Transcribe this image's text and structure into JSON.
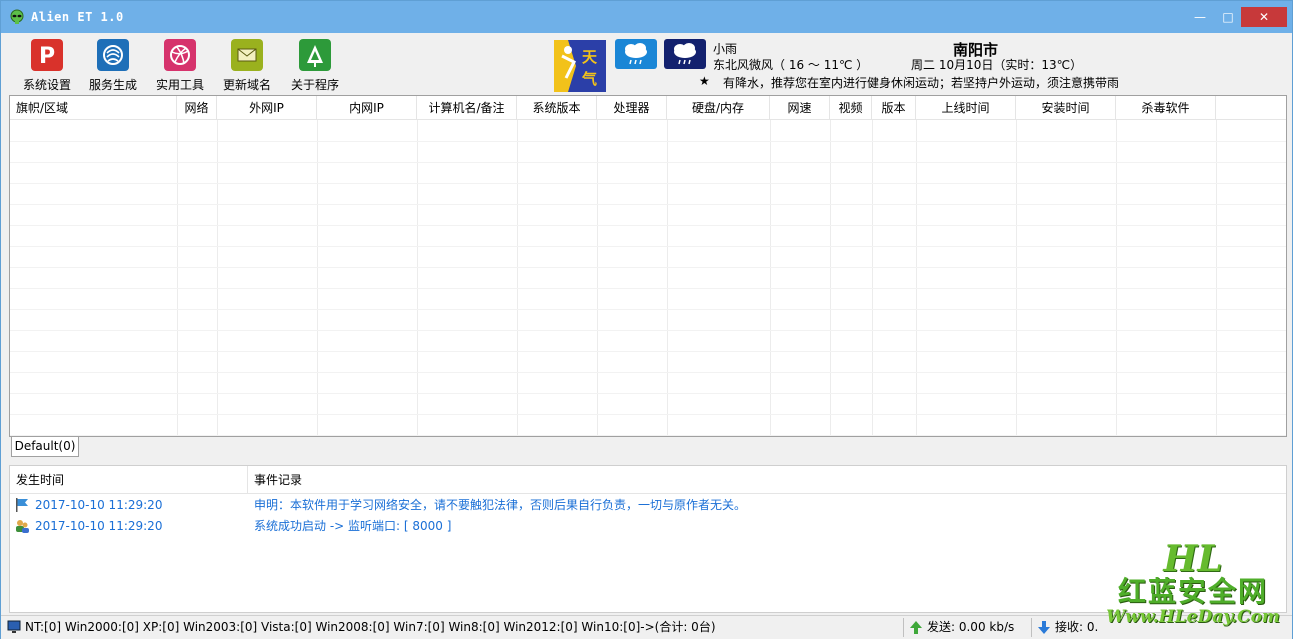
{
  "window": {
    "title": "Alien ET 1.0",
    "min": "—",
    "max": "□",
    "close": "✕"
  },
  "toolbar": {
    "buttons": [
      {
        "label": "系统设置",
        "icon": "pinterest-icon",
        "color": "#d9322b"
      },
      {
        "label": "服务生成",
        "icon": "spiral-icon",
        "color": "#1e6fb8"
      },
      {
        "label": "实用工具",
        "icon": "dribbble-icon",
        "color": "#d6336c"
      },
      {
        "label": "更新域名",
        "icon": "envelope-icon",
        "color": "#9ab11e"
      },
      {
        "label": "关于程序",
        "icon": "tree-icon",
        "color": "#2d9a3a"
      }
    ]
  },
  "weather": {
    "logo_text_1": "天",
    "logo_text_2": "气",
    "condition": "小雨",
    "wind_temp": "东北风微风（ 16 ～ 11℃ ）",
    "date": "周二 10月10日（实时：13℃）",
    "city": "南阳市",
    "advice_star": "★",
    "advice": "有降水，推荐您在室内进行健身休闲运动；若坚持户外运动，须注意携带雨"
  },
  "table": {
    "columns": [
      "旗帜/区域",
      "网络",
      "外网IP",
      "内网IP",
      "计算机名/备注",
      "系统版本",
      "处理器",
      "硬盘/内存",
      "网速",
      "视频",
      "版本",
      "上线时间",
      "安装时间",
      "杀毒软件"
    ],
    "tab": "Default(0)"
  },
  "log": {
    "columns": [
      "发生时间",
      "事件记录"
    ],
    "rows": [
      {
        "time": "2017-10-10 11:29:20",
        "msg": "申明：本软件用于学习网络安全，请不要触犯法律，否则后果自行负责，一切与原作者无关。",
        "icon": "flag-icon"
      },
      {
        "time": "2017-10-10 11:29:20",
        "msg": "系统成功启动 -> 监听端口: [ 8000 ]",
        "icon": "users-icon"
      }
    ]
  },
  "status": {
    "os_counts": "NT:[0] Win2000:[0] XP:[0] Win2003:[0] Vista:[0] Win2008:[0] Win7:[0] Win8:[0] Win2012:[0] Win10:[0]->(合计: 0台)",
    "send": "发送: 0.00 kb/s",
    "recv": "接收: 0."
  },
  "watermark": {
    "top": "HL",
    "middle": "红蓝安全网",
    "bottom": "Www.HLeDay.Com"
  }
}
